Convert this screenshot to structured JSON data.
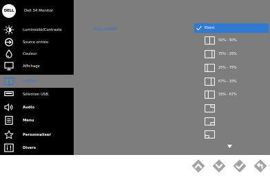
{
  "brand": {
    "logo_text": "DELL",
    "title": "Dell 34 Monitor"
  },
  "menu": [
    {
      "label": "Luminosité/Contraste",
      "icon": "brightness-icon"
    },
    {
      "label": "Source entrée",
      "icon": "input-source-icon"
    },
    {
      "label": "Couleur",
      "icon": "color-icon"
    },
    {
      "label": "Affichage",
      "icon": "display-icon"
    },
    {
      "label": "PIP/PBP",
      "icon": "pip-pbp-icon"
    },
    {
      "label": "Sélection USB",
      "icon": "usb-icon"
    },
    {
      "label": "Audio",
      "icon": "audio-icon"
    },
    {
      "label": "Menu",
      "icon": "menu-icon"
    },
    {
      "label": "Personnaliser",
      "icon": "star-icon"
    },
    {
      "label": "Divers",
      "icon": "misc-icon"
    }
  ],
  "submenu": {
    "label": "Mode PIP/PBP"
  },
  "options": [
    {
      "label": "Eteint",
      "selected": true
    },
    {
      "label": "50% - 50%",
      "icon": "split-50-50-icon"
    },
    {
      "label": "75% - 25%",
      "icon": "split-75-25-icon"
    },
    {
      "label": "25% - 75%",
      "icon": "split-25-75-icon"
    },
    {
      "label": "67% - 33%",
      "icon": "split-67-33-icon"
    },
    {
      "label": "33% - 67%",
      "icon": "split-33-67-icon"
    },
    {
      "label": "",
      "icon": "pip-top-right-icon"
    },
    {
      "label": "",
      "icon": "pip-bottom-right-icon"
    },
    {
      "label": "",
      "icon": "pip-bottom-left-icon"
    }
  ],
  "buttons": [
    {
      "name": "up-button",
      "icon": "chevron-up-icon"
    },
    {
      "name": "down-button",
      "icon": "chevron-down-icon"
    },
    {
      "name": "confirm-button",
      "icon": "check-icon"
    },
    {
      "name": "back-button",
      "icon": "back-arrow-icon"
    }
  ],
  "colors": {
    "accent": "#2f7bd3",
    "panel": "#7d7d7d",
    "sidebar": "#000000",
    "button": "#a3a3a3"
  }
}
